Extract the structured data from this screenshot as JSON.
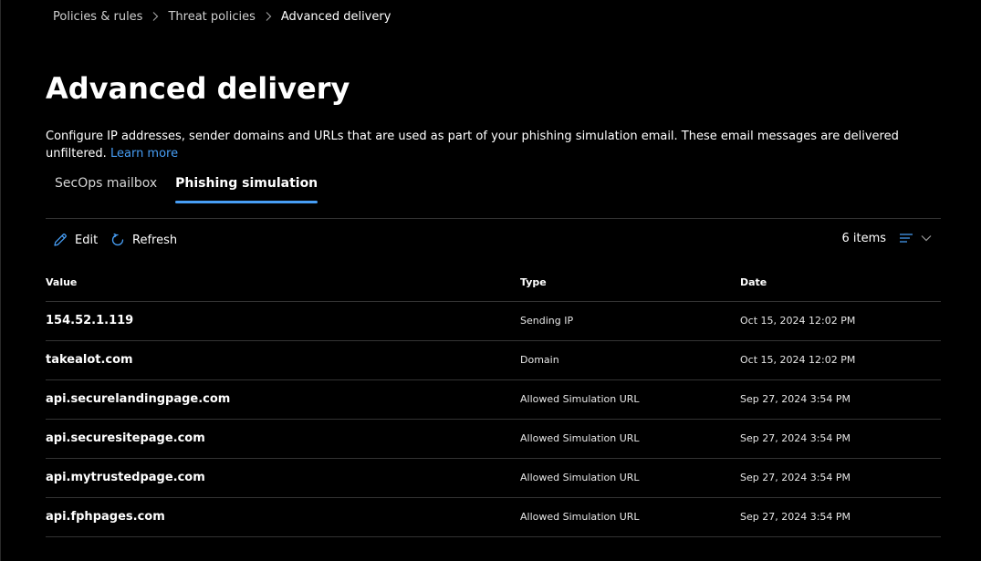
{
  "breadcrumb": {
    "items": [
      "Policies & rules",
      "Threat policies",
      "Advanced delivery"
    ]
  },
  "page": {
    "title": "Advanced delivery",
    "description": "Configure IP addresses, sender domains and URLs that are used as part of your phishing simulation email. These email messages are delivered unfiltered.",
    "learn_more": "Learn more"
  },
  "tabs": [
    {
      "label": "SecOps mailbox",
      "active": false
    },
    {
      "label": "Phishing simulation",
      "active": true
    }
  ],
  "toolbar": {
    "edit_label": "Edit",
    "refresh_label": "Refresh",
    "items_count": "6 items",
    "icons": {
      "edit": "pencil-icon",
      "refresh": "refresh-icon",
      "filter": "filter-lines-icon",
      "chevron": "chevron-down-icon"
    }
  },
  "table": {
    "columns": [
      "Value",
      "Type",
      "Date"
    ],
    "rows": [
      {
        "value": "154.52.1.119",
        "type": "Sending IP",
        "date": "Oct 15, 2024 12:02 PM"
      },
      {
        "value": "takealot.com",
        "type": "Domain",
        "date": "Oct 15, 2024 12:02 PM"
      },
      {
        "value": "api.securelandingpage.com",
        "type": "Allowed Simulation URL",
        "date": "Sep 27, 2024 3:54 PM"
      },
      {
        "value": "api.securesitepage.com",
        "type": "Allowed Simulation URL",
        "date": "Sep 27, 2024 3:54 PM"
      },
      {
        "value": "api.mytrustedpage.com",
        "type": "Allowed Simulation URL",
        "date": "Sep 27, 2024 3:54 PM"
      },
      {
        "value": "api.fphpages.com",
        "type": "Allowed Simulation URL",
        "date": "Sep 27, 2024 3:54 PM"
      }
    ]
  },
  "colors": {
    "background": "#000000",
    "accent": "#479ef5",
    "divider": "#333333"
  }
}
